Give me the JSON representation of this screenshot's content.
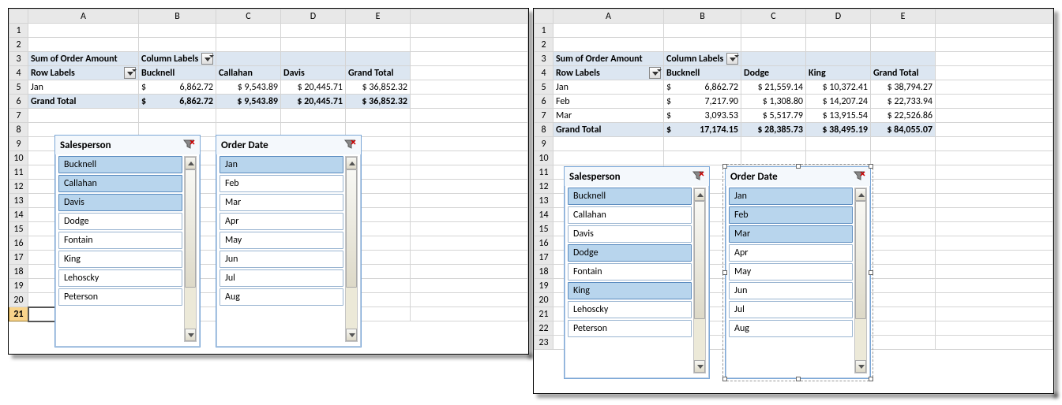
{
  "left": {
    "columns": [
      "A",
      "B",
      "C",
      "D",
      "E"
    ],
    "rows": [
      "1",
      "2",
      "3",
      "4",
      "5",
      "6",
      "7",
      "8",
      "9",
      "10",
      "11",
      "12",
      "13",
      "14",
      "15",
      "16",
      "17",
      "18",
      "19",
      "20",
      "21"
    ],
    "active_row": "21",
    "pivot": {
      "corner": "Sum of Order Amount",
      "col_field": "Column Labels",
      "row_field": "Row Labels",
      "col_headers": [
        "Bucknell",
        "Callahan",
        "Davis",
        "Grand Total"
      ],
      "rows": [
        {
          "label": "Jan",
          "values": [
            "$    6,862.72",
            "$ 9,543.89",
            "$ 20,445.71",
            "$ 36,852.32"
          ]
        }
      ],
      "total": {
        "label": "Grand Total",
        "values": [
          "$    6,862.72",
          "$ 9,543.89",
          "$ 20,445.71",
          "$ 36,852.32"
        ]
      }
    },
    "slicers": [
      {
        "title": "Salesperson",
        "items": [
          "Bucknell",
          "Callahan",
          "Davis",
          "Dodge",
          "Fontain",
          "King",
          "Lehoscky",
          "Peterson"
        ],
        "selected": [
          "Bucknell",
          "Callahan",
          "Davis"
        ],
        "thumb_top": 0,
        "thumb_height": 75
      },
      {
        "title": "Order Date",
        "items": [
          "Jan",
          "Feb",
          "Mar",
          "Apr",
          "May",
          "Jun",
          "Jul",
          "Aug"
        ],
        "selected": [
          "Jan"
        ],
        "thumb_top": 0,
        "thumb_height": 75
      }
    ]
  },
  "right": {
    "columns": [
      "A",
      "B",
      "C",
      "D",
      "E"
    ],
    "rows": [
      "1",
      "2",
      "3",
      "4",
      "5",
      "6",
      "7",
      "8",
      "9",
      "10",
      "11",
      "12",
      "13",
      "14",
      "15",
      "16",
      "17",
      "18",
      "19",
      "20",
      "21",
      "22",
      "23"
    ],
    "pivot": {
      "corner": "Sum of Order Amount",
      "col_field": "Column Labels",
      "row_field": "Row Labels",
      "col_headers": [
        "Bucknell",
        "Dodge",
        "King",
        "Grand Total"
      ],
      "rows": [
        {
          "label": "Jan",
          "values": [
            "$    6,862.72",
            "$ 21,559.14",
            "$ 10,372.41",
            "$ 38,794.27"
          ]
        },
        {
          "label": "Feb",
          "values": [
            "$    7,217.90",
            "$  1,308.80",
            "$ 14,207.24",
            "$ 22,733.94"
          ]
        },
        {
          "label": "Mar",
          "values": [
            "$    3,093.53",
            "$  5,517.79",
            "$ 13,915.54",
            "$ 22,526.86"
          ]
        }
      ],
      "total": {
        "label": "Grand Total",
        "values": [
          "$ 17,174.15",
          "$ 28,385.73",
          "$ 38,495.19",
          "$ 84,055.07"
        ]
      }
    },
    "slicers": [
      {
        "title": "Salesperson",
        "items": [
          "Bucknell",
          "Callahan",
          "Davis",
          "Dodge",
          "Fontain",
          "King",
          "Lehoscky",
          "Peterson"
        ],
        "selected": [
          "Bucknell",
          "Dodge",
          "King"
        ],
        "thumb_top": 0,
        "thumb_height": 75
      },
      {
        "title": "Order Date",
        "items": [
          "Jan",
          "Feb",
          "Mar",
          "Apr",
          "May",
          "Jun",
          "Jul",
          "Aug"
        ],
        "selected": [
          "Jan",
          "Feb",
          "Mar"
        ],
        "thumb_top": 0,
        "thumb_height": 75,
        "active": true
      }
    ]
  },
  "chart_data": [
    {
      "type": "table",
      "title": "Sum of Order Amount (Left Pivot)",
      "categories": [
        "Bucknell",
        "Callahan",
        "Davis",
        "Grand Total"
      ],
      "series": [
        {
          "name": "Jan",
          "values": [
            6862.72,
            9543.89,
            20445.71,
            36852.32
          ]
        },
        {
          "name": "Grand Total",
          "values": [
            6862.72,
            9543.89,
            20445.71,
            36852.32
          ]
        }
      ]
    },
    {
      "type": "table",
      "title": "Sum of Order Amount (Right Pivot)",
      "categories": [
        "Bucknell",
        "Dodge",
        "King",
        "Grand Total"
      ],
      "series": [
        {
          "name": "Jan",
          "values": [
            6862.72,
            21559.14,
            10372.41,
            38794.27
          ]
        },
        {
          "name": "Feb",
          "values": [
            7217.9,
            1308.8,
            14207.24,
            22733.94
          ]
        },
        {
          "name": "Mar",
          "values": [
            3093.53,
            5517.79,
            13915.54,
            22526.86
          ]
        },
        {
          "name": "Grand Total",
          "values": [
            17174.15,
            28385.73,
            38495.19,
            84055.07
          ]
        }
      ]
    }
  ]
}
